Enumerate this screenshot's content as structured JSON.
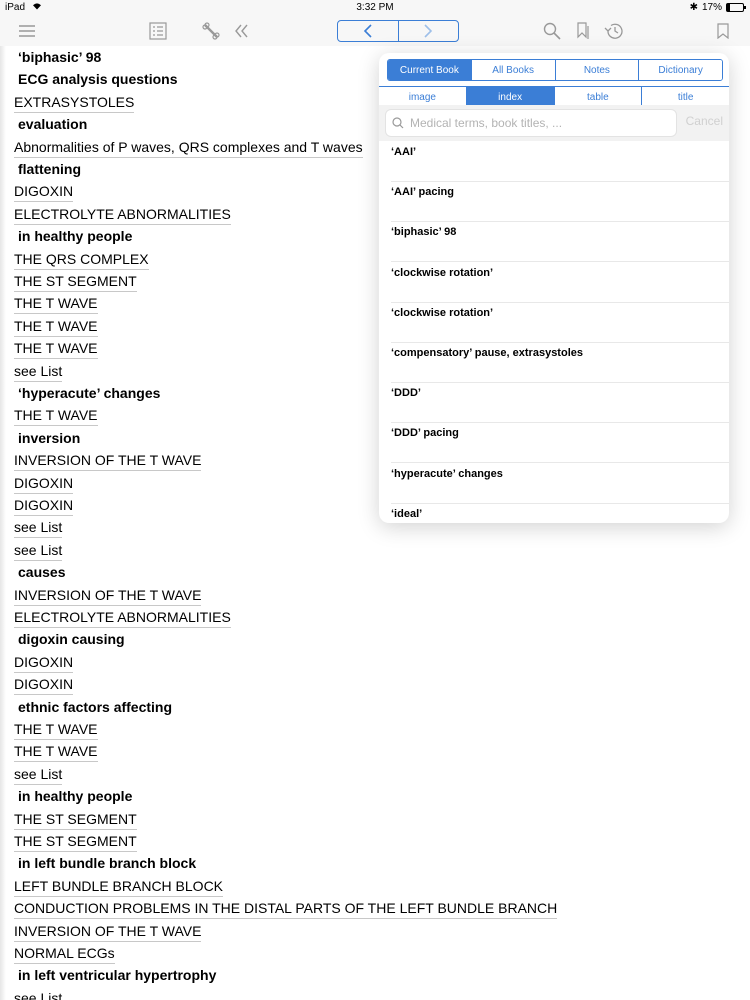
{
  "status": {
    "device": "iPad",
    "time": "3:32 PM",
    "battery": "17%",
    "battery_level": 0.17
  },
  "toolbar": {
    "icons": [
      "menu-icon",
      "list-icon",
      "bone-icon",
      "double-chevron-left-icon",
      "chevron-left-icon",
      "chevron-right-icon",
      "search-icon",
      "bookmark-list-icon",
      "history-icon",
      "bookmark-icon"
    ]
  },
  "entries": [
    {
      "text": "‘biphasic’ 98",
      "type": "heading"
    },
    {
      "text": "ECG analysis questions",
      "type": "heading"
    },
    {
      "text": "EXTRASYSTOLES",
      "type": "link"
    },
    {
      "text": "evaluation",
      "type": "heading"
    },
    {
      "text": "Abnormalities of P waves, QRS complexes and T waves",
      "type": "link"
    },
    {
      "text": "flattening",
      "type": "heading"
    },
    {
      "text": "DIGOXIN",
      "type": "link"
    },
    {
      "text": "ELECTROLYTE ABNORMALITIES",
      "type": "link"
    },
    {
      "text": "in healthy people",
      "type": "heading"
    },
    {
      "text": "THE QRS COMPLEX",
      "type": "link"
    },
    {
      "text": "THE ST SEGMENT",
      "type": "link"
    },
    {
      "text": "THE T WAVE",
      "type": "link"
    },
    {
      "text": "THE T WAVE",
      "type": "link"
    },
    {
      "text": "THE T WAVE",
      "type": "link"
    },
    {
      "text": "see List",
      "type": "link"
    },
    {
      "text": "‘hyperacute’ changes",
      "type": "heading"
    },
    {
      "text": "THE T WAVE",
      "type": "link"
    },
    {
      "text": "inversion",
      "type": "heading"
    },
    {
      "text": "INVERSION OF THE T WAVE",
      "type": "link"
    },
    {
      "text": "DIGOXIN",
      "type": "link"
    },
    {
      "text": "DIGOXIN",
      "type": "link"
    },
    {
      "text": "see List",
      "type": "link"
    },
    {
      "text": "see List",
      "type": "link"
    },
    {
      "text": "causes",
      "type": "heading"
    },
    {
      "text": "INVERSION OF THE T WAVE",
      "type": "link"
    },
    {
      "text": "ELECTROLYTE ABNORMALITIES",
      "type": "link"
    },
    {
      "text": "digoxin causing",
      "type": "heading"
    },
    {
      "text": "DIGOXIN",
      "type": "link"
    },
    {
      "text": "DIGOXIN",
      "type": "link"
    },
    {
      "text": "ethnic factors affecting",
      "type": "heading"
    },
    {
      "text": "THE T WAVE",
      "type": "link"
    },
    {
      "text": "THE T WAVE",
      "type": "link"
    },
    {
      "text": "see List",
      "type": "link"
    },
    {
      "text": "in healthy people",
      "type": "heading"
    },
    {
      "text": "THE ST SEGMENT",
      "type": "link"
    },
    {
      "text": "THE ST SEGMENT",
      "type": "link"
    },
    {
      "text": "in left bundle branch block",
      "type": "heading"
    },
    {
      "text": "LEFT BUNDLE BRANCH BLOCK",
      "type": "link"
    },
    {
      "text": "CONDUCTION PROBLEMS IN THE DISTAL PARTS OF THE LEFT BUNDLE BRANCH",
      "type": "link"
    },
    {
      "text": "INVERSION OF THE T WAVE",
      "type": "link"
    },
    {
      "text": "NORMAL ECGs",
      "type": "link"
    },
    {
      "text": "in left ventricular hypertrophy",
      "type": "heading"
    },
    {
      "text": "see List",
      "type": "link"
    }
  ],
  "popover": {
    "scope_tabs": [
      {
        "label": "Current Book",
        "active": true
      },
      {
        "label": "All Books",
        "active": false
      },
      {
        "label": "Notes",
        "active": false
      },
      {
        "label": "Dictionary",
        "active": false
      }
    ],
    "type_tabs": [
      {
        "label": "image",
        "active": false
      },
      {
        "label": "index",
        "active": true
      },
      {
        "label": "table",
        "active": false
      },
      {
        "label": "title",
        "active": false
      }
    ],
    "search": {
      "placeholder": "Medical terms, book titles, ...",
      "value": ""
    },
    "cancel_label": "Cancel",
    "results": [
      "‘AAI’",
      "‘AAI’ pacing",
      "‘biphasic’ 98",
      "‘clockwise rotation’",
      "‘clockwise rotation’",
      "‘compensatory’ pause, extrasystoles",
      "‘DDD’",
      "‘DDD’ pacing",
      "‘hyperacute’ changes",
      "‘ideal’"
    ]
  },
  "colors": {
    "accent": "#3b7ed6",
    "toolbar_icon": "#999999"
  }
}
